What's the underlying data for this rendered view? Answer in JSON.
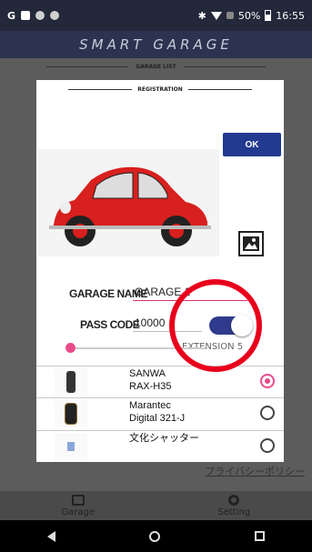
{
  "status": {
    "left_letter": "G",
    "battery": "50%",
    "time": "16:55"
  },
  "app": {
    "title": "SMART GARAGE",
    "list_title": "GARAGE LIST",
    "privacy": "プライバシーポリシー"
  },
  "dialog": {
    "title": "REGISTRATION",
    "ok_label": "OK",
    "garage_name_label": "GARAGE NAME",
    "garage_name_value": "GARAGE 1",
    "pass_code_label": "PASS CODE",
    "pass_code_value": "10000",
    "extension_label": "EXTENSION 5",
    "extension_toggle_on": true,
    "slider_level": 0.02,
    "image_alt": "red-beetle-car-photo"
  },
  "devices": [
    {
      "line1": "SANWA",
      "line2": "RAX-H35",
      "selected": true
    },
    {
      "line1": "Marantec",
      "line2": "Digital 321-J",
      "selected": false
    },
    {
      "line1": "文化シャッター",
      "line2": "",
      "selected": false
    }
  ],
  "nav": {
    "garage": "Garage",
    "setting": "Setting"
  },
  "colors": {
    "accent_pink": "#e94b8a",
    "ok_blue": "#223a8f",
    "toggle_blue": "#2f3a8c",
    "annotation_red": "#e8001c"
  }
}
